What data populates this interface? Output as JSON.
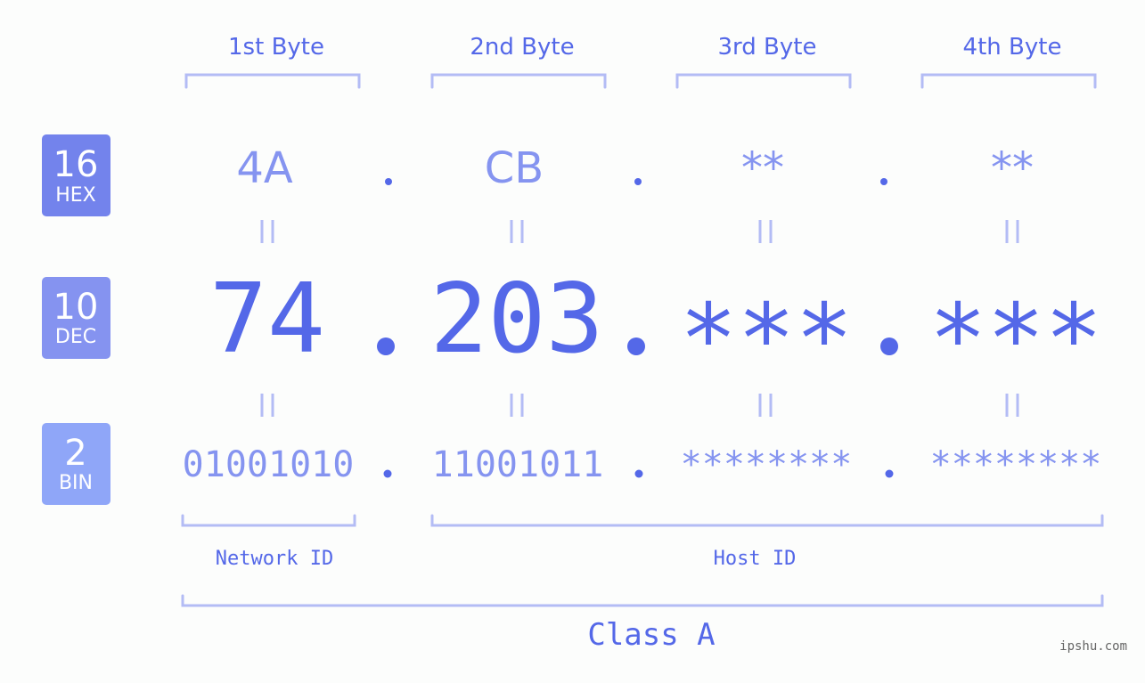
{
  "byte_headers": [
    "1st Byte",
    "2nd Byte",
    "3rd Byte",
    "4th Byte"
  ],
  "badges": [
    {
      "number": "16",
      "label": "HEX",
      "color": "#7383ec"
    },
    {
      "number": "10",
      "label": "DEC",
      "color": "#8593f0"
    },
    {
      "number": "2",
      "label": "BIN",
      "color": "#8fa6f8"
    }
  ],
  "hex": [
    "4A",
    "CB",
    "**",
    "**"
  ],
  "dec": [
    "74",
    "203",
    "***",
    "***"
  ],
  "bin": [
    "01001010",
    "11001011",
    "********",
    "********"
  ],
  "separator": ".",
  "equals_symbol": "||",
  "network_id_label": "Network ID",
  "host_id_label": "Host ID",
  "class_label": "Class A",
  "watermark": "ipshu.com",
  "colors": {
    "primary": "#5468e8",
    "light": "#8594f0",
    "bracket": "#b3bcf5",
    "background": "#fcfdfc"
  }
}
